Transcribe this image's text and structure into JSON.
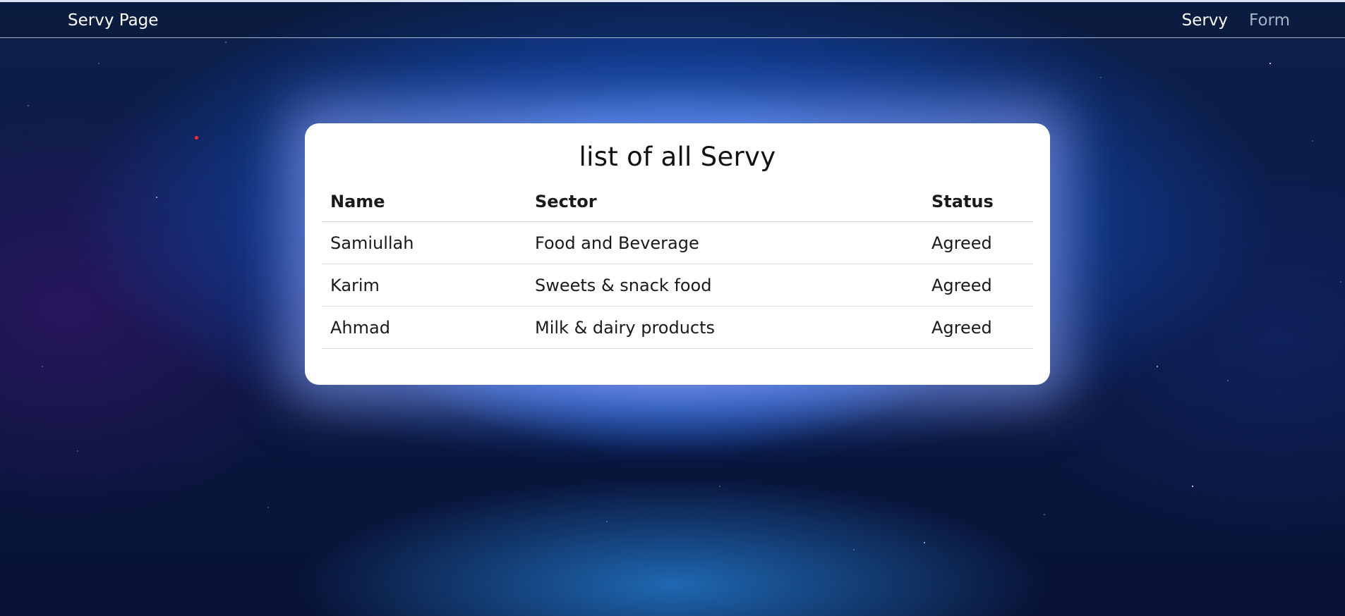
{
  "navbar": {
    "brand": "Servy Page",
    "links": [
      {
        "label": "Servy",
        "active": true
      },
      {
        "label": "Form",
        "active": false
      }
    ]
  },
  "card": {
    "title": "list of all Servy",
    "table": {
      "headers": [
        "Name",
        "Sector",
        "Status"
      ],
      "rows": [
        {
          "name": "Samiullah",
          "sector": "Food and Beverage",
          "status": "Agreed"
        },
        {
          "name": "Karim",
          "sector": "Sweets & snack food",
          "status": "Agreed"
        },
        {
          "name": "Ahmad",
          "sector": "Milk & dairy products",
          "status": "Agreed"
        }
      ]
    }
  },
  "colors": {
    "card_background": "#ffffff",
    "nav_active": "#ffffff",
    "nav_muted": "#a9b3c6",
    "glow": "#96a5fa"
  }
}
